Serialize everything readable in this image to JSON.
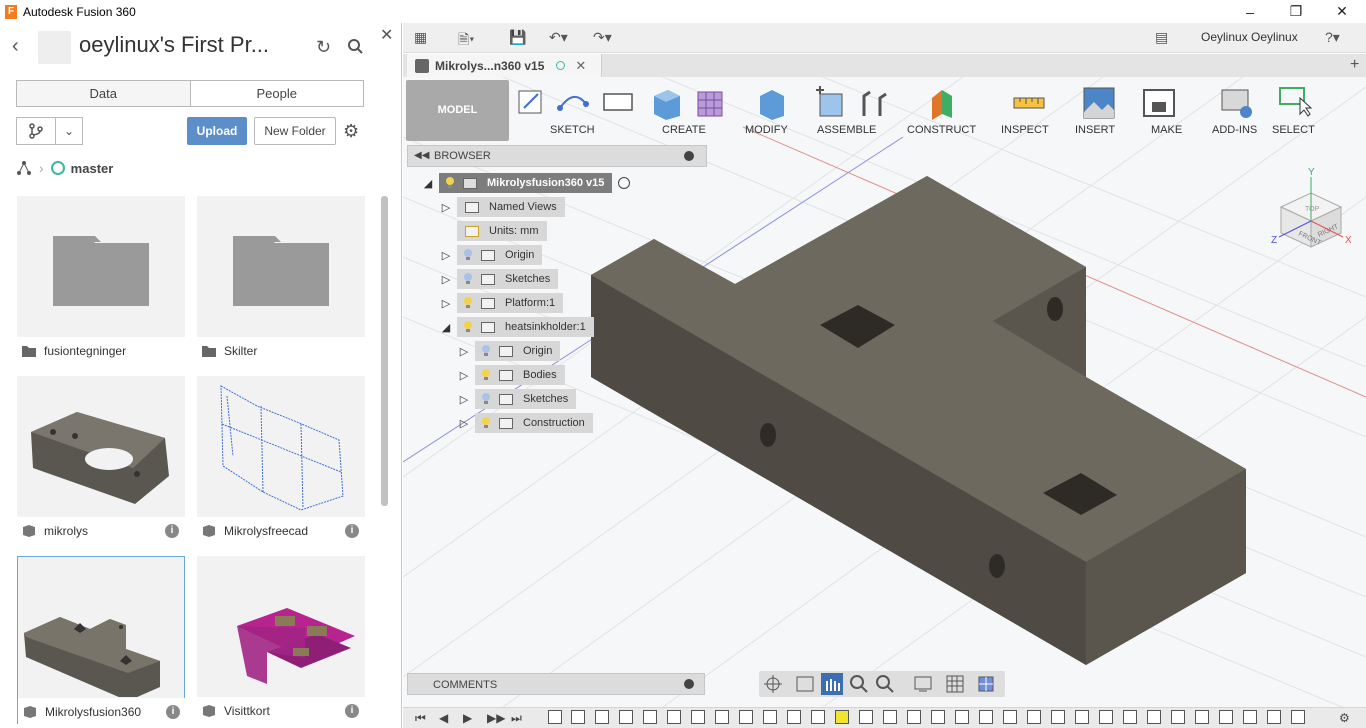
{
  "window": {
    "title": "Autodesk Fusion 360",
    "logo": "F"
  },
  "data_panel": {
    "project_title": "oeylinux's First Pr...",
    "tabs": [
      "Data",
      "People"
    ],
    "active_tab": "Data",
    "upload_label": "Upload",
    "new_folder_label": "New Folder",
    "branch": "master",
    "items": [
      {
        "label": "fusiontegninger",
        "kind": "folder"
      },
      {
        "label": "Skilter",
        "kind": "folder"
      },
      {
        "label": "mikrolys",
        "kind": "design",
        "info": "i"
      },
      {
        "label": "Mikrolysfreecad",
        "kind": "design",
        "info": "i"
      },
      {
        "label": "Mikrolysfusion360",
        "kind": "design",
        "info": "i",
        "selected": true
      },
      {
        "label": "Visittkort",
        "kind": "design",
        "info": "i"
      }
    ]
  },
  "workspace": {
    "user": "Oeylinux Oeylinux",
    "doc_tab": "Mikrolys...n360 v15",
    "workspace_mode": "MODEL",
    "toolbar_groups": [
      "SKETCH",
      "CREATE",
      "MODIFY",
      "ASSEMBLE",
      "CONSTRUCT",
      "INSPECT",
      "INSERT",
      "MAKE",
      "ADD-INS",
      "SELECT"
    ],
    "browser_title": "BROWSER",
    "tree": {
      "root": "Mikrolysfusion360 v15",
      "items": [
        {
          "label": "Named Views"
        },
        {
          "label": "Units: mm"
        },
        {
          "label": "Origin"
        },
        {
          "label": "Sketches"
        },
        {
          "label": "Platform:1"
        },
        {
          "label": "heatsinkholder:1"
        },
        {
          "label": "Origin"
        },
        {
          "label": "Bodies"
        },
        {
          "label": "Sketches"
        },
        {
          "label": "Construction"
        }
      ]
    },
    "comments_label": "COMMENTS",
    "viewcube": {
      "front": "FRONT",
      "right": "RIGHT",
      "top": "TOP",
      "axes": [
        "X",
        "Y",
        "Z"
      ]
    }
  },
  "colors": {
    "accent": "#5c8fca",
    "body": "#6b655a",
    "highlight": "#f0e430"
  }
}
